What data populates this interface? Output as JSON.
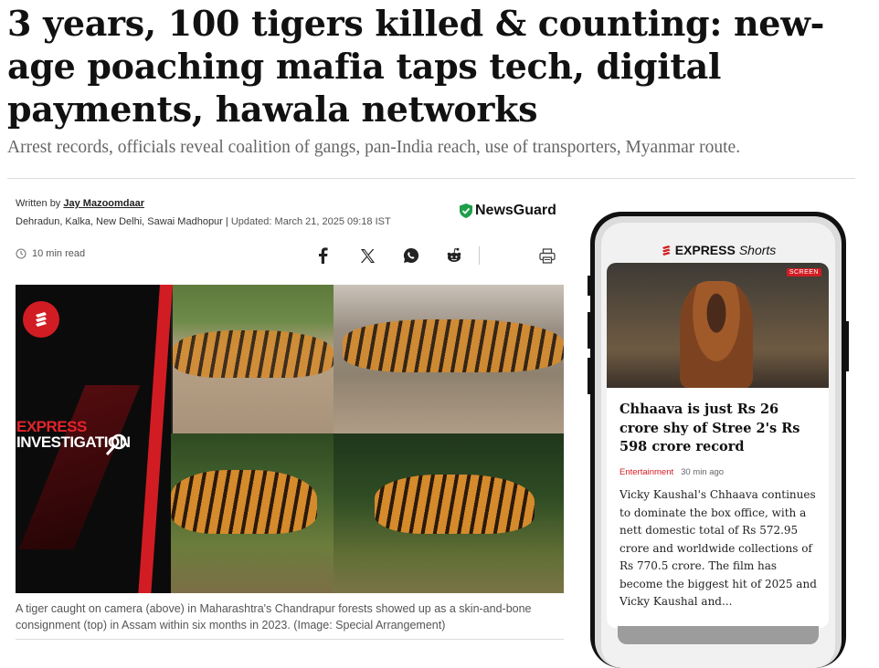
{
  "article": {
    "headline": "3 years, 100 tigers killed & counting: new-age poaching mafia taps tech, digital payments, hawala networks",
    "subheadline": "Arrest records, officials reveal coalition of gangs, pan-India reach, use of transporters, Myanmar route.",
    "byline_prefix": "Written by ",
    "author": "Jay Mazoomdaar",
    "locations": "Dehradun, Kalka, New Delhi, Sawai Madhopur",
    "separator": " | ",
    "updated": "Updated: March 21, 2025 09:18 IST",
    "read_time": "10 min read",
    "newsguard_label": "NewsGuard",
    "image_caption": "A tiger caught on camera (above) in Maharashtra's Chandrapur forests showed up as a skin-and-bone consignment (top) in Assam within six months in 2023. (Image: Special Arrangement)",
    "image_overlay_line1": "EXPRESS",
    "image_overlay_line2": "INVESTIGATION"
  },
  "share": {
    "icons": [
      "facebook-icon",
      "x-icon",
      "whatsapp-icon",
      "reddit-icon",
      "print-icon"
    ]
  },
  "shorts": {
    "brand": "EXPRESS",
    "label": "Shorts",
    "badge": "SCREEN",
    "card_title": "Chhaava is just Rs 26 crore shy of Stree 2's Rs 598 crore record",
    "category": "Entertainment",
    "time_ago": "30 min ago",
    "card_body": "Vicky Kaushal's Chhaava continues to dominate the box office, with a nett domestic total of Rs 572.95 crore and worldwide collections of Rs 770.5 crore. The film has become the biggest hit of 2025 and Vicky Kaushal and..."
  },
  "colors": {
    "brand_red": "#d21c23",
    "newsguard_green": "#1e9e4a",
    "headline": "#111111",
    "muted": "#666666"
  }
}
